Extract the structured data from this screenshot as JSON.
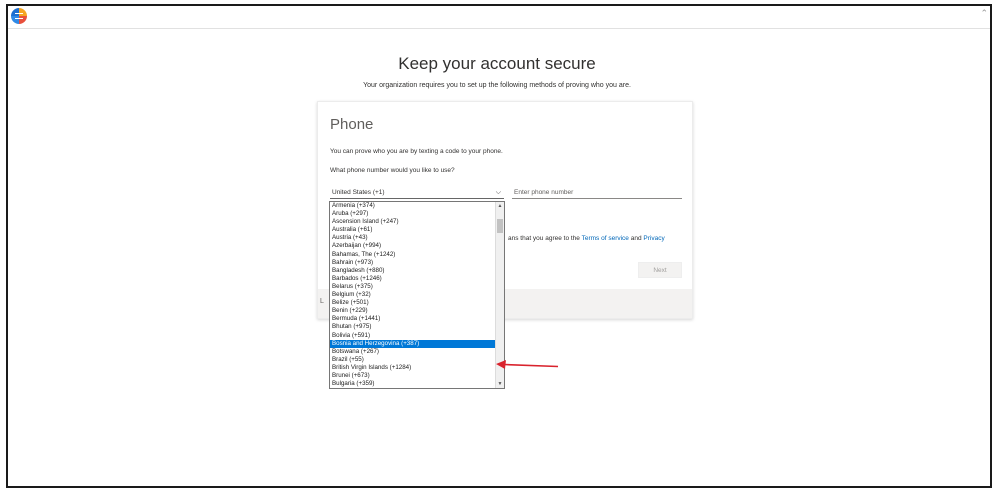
{
  "page": {
    "heading": "Keep your account secure",
    "subheading": "Your organization requires you to set up the following methods of proving who you are."
  },
  "card": {
    "title": "Phone",
    "description": "You can prove who you are by texting a code to your phone.",
    "question": "What phone number would you like to use?",
    "country_selected": "United States (+1)",
    "phone_placeholder": "Enter phone number",
    "terms_prefix": "ans that you agree to the ",
    "terms_link": "Terms of service",
    "terms_and": " and ",
    "privacy_link": "Privacy",
    "next_label": "Next",
    "footer_letter": "L"
  },
  "dropdown": {
    "options": [
      "Armenia (+374)",
      "Aruba (+297)",
      "Ascension Island (+247)",
      "Australia (+61)",
      "Austria (+43)",
      "Azerbaijan (+994)",
      "Bahamas, The (+1242)",
      "Bahrain (+973)",
      "Bangladesh (+880)",
      "Barbados (+1246)",
      "Belarus (+375)",
      "Belgium (+32)",
      "Belize (+501)",
      "Benin (+229)",
      "Bermuda (+1441)",
      "Bhutan (+975)",
      "Bolivia (+591)",
      "Bosnia and Herzegovina (+387)",
      "Botswana (+267)",
      "Brazil (+55)",
      "British Virgin Islands (+1284)",
      "Brunei (+673)",
      "Bulgaria (+359)"
    ],
    "selected_index": 17
  },
  "colors": {
    "accent": "#0067b8",
    "selected_bg": "#0078d7",
    "annotation": "#d9232d"
  },
  "icons": {
    "app_logo": "app-logo-icon",
    "select_chevron": "chevron-down-icon",
    "scroll_up": "scroll-up-arrow-icon",
    "scroll_down": "scroll-down-arrow-icon",
    "annotation": "red-arrow-icon"
  }
}
